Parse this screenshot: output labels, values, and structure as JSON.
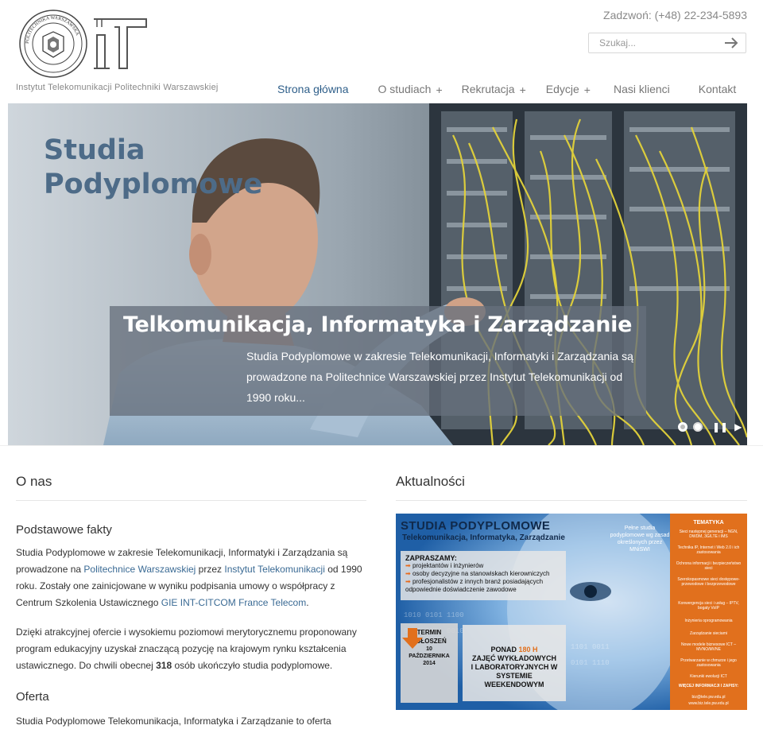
{
  "header": {
    "institute_name": "Instytut Telekomunikacji Politechniki Warszawskiej",
    "phone": "Zadzwoń: (+48) 22-234-5893",
    "search": {
      "placeholder": "Szukaj..."
    },
    "nav": [
      {
        "label": "Strona główna",
        "has_submenu": false,
        "active": true
      },
      {
        "label": "O studiach",
        "has_submenu": true,
        "active": false
      },
      {
        "label": "Rekrutacja",
        "has_submenu": true,
        "active": false
      },
      {
        "label": "Edycje",
        "has_submenu": true,
        "active": false
      },
      {
        "label": "Nasi klienci",
        "has_submenu": false,
        "active": false
      },
      {
        "label": "Kontakt",
        "has_submenu": false,
        "active": false
      }
    ],
    "plus_symbol": "+",
    "seal_text": "POLITECHNIKA WARSZAWSKA"
  },
  "hero": {
    "title": "Studia Podyplomowe",
    "caption_title": "Telkomunikacja, Informatyka i Zarządzanie",
    "caption_text": "Studia Podyplomowe w zakresie Telekomunikacji, Informatyki i Zarządzania są prowadzone na Politechnice Warszawskiej przez Instytut Telekomunikacji od 1990 roku...",
    "slides": 2,
    "active_slide": 1,
    "pause_symbol": "❚❚",
    "next_symbol": "▶"
  },
  "about": {
    "title": "O nas",
    "facts_title": "Podstawowe fakty",
    "p1_a": "Studia Podyplomowe w zakresie Telekomunikacji, Informatyki i Zarządzania są prowadzone na ",
    "p1_link1": "Politechnice Warszawskiej",
    "p1_b": " przez ",
    "p1_link2": "Instytut Telekomunikacji",
    "p1_c": " od 1990 roku. Zostały one zainicjowane w wyniku podpisania umowy o współpracy z Centrum Szkolenia Ustawicznego ",
    "p1_link3": "GIE INT-CITCOM France Telecom",
    "p1_d": ".",
    "p2_a": "Dzięki atrakcyjnej ofercie i wysokiemu poziomowi merytorycznemu proponowany program edukacyjny uzyskał znaczącą pozycję na krajowym rynku kształcenia ustawicznego. Do chwili obecnej ",
    "p2_count": "318",
    "p2_b": " osób ukończyło studia podyplomowe.",
    "offer_title": "Oferta",
    "p3": "Studia Podyplomowe Telekomunikacja, Informatyka i Zarządzanie to oferta edukacyjna przeznaczona dla osób, które mają potrzebę uaktualnienia,"
  },
  "news": {
    "title": "Aktualności",
    "banner": {
      "headline": "STUDIA PODYPLOMOWE",
      "subheadline": "Telekomunikacja, Informatyka, Zarządzanie",
      "invite_title": "ZAPRASZAMY:",
      "invite_items": [
        "projektantów i inżynierów",
        "osoby decyzyjne na stanowiskach kierowniczych",
        "profesjonalistów z innych branż posiadających odpowiednie doświadczenie zawodowe"
      ],
      "side_note": "Pełne studia podyplomowe wg zasad określonych przez MNiSWI",
      "topics_title": "TEMATYKA",
      "topics": [
        "Sieci następnej generacji – NGN, DWDM, 3G/LTE i IMS",
        "Technika IP, Internet i Web 2.0 i ich zastosowania",
        "Ochrona informacji i bezpieczeństwo sieci",
        "Szerokopasmowe sieci dostępowe- przewodowe i bezprzewodowe",
        "Konwergencja sieci i usług – IPTV, bogaty VoIP",
        "Inżynieria oprogramowania",
        "Zarządzanie sieciami",
        "Nowe modele biznesowe ICT – MVNO/MVNE",
        "Przetwarzanie w chmurze i jego zastosowania",
        "Kierunki ewolucji ICT",
        "WIĘCEJ INFORMACJI I ZAPISY:",
        "biz@tele.pw.edu.pl",
        "www.biz.tele.pw.edu.pl"
      ],
      "deadline_title": "TERMIN ZGŁOSZEŃ",
      "deadline_date": "10 PAŹDZIERNIKA 2014",
      "hours_a": "PONAD",
      "hours_num": "180 H",
      "hours_b": "ZAJĘĆ WYKŁADOWYCH I LABORATORYJNYCH W SYSTEMIE WEEKENDOWYM"
    }
  },
  "colors": {
    "nav_active": "#2f5f8a",
    "link": "#3a6a94",
    "hero_title": "#4d6b88",
    "banner_orange": "#e1701d",
    "banner_navy": "#10294a"
  }
}
